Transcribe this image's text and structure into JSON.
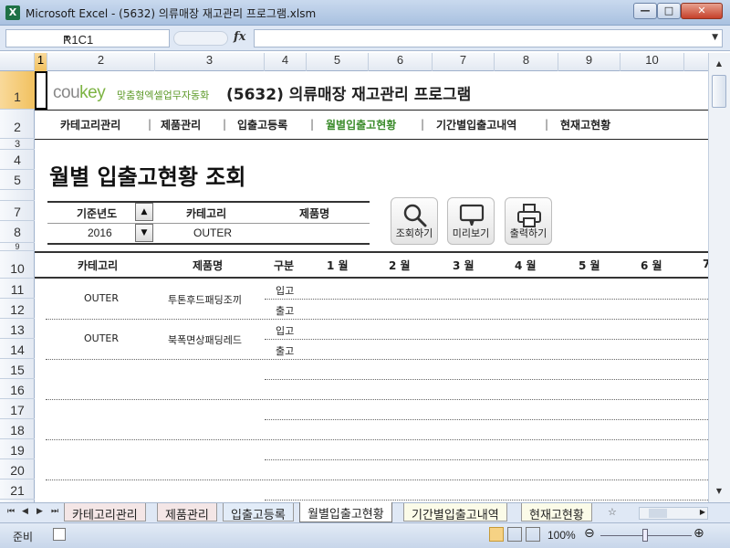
{
  "window": {
    "title": "Microsoft Excel - (5632) 의류매장 재고관리 프로그램.xlsm",
    "app_icon": "excel-icon",
    "buttons": {
      "minimize": "—",
      "maximize": "□",
      "close": "✕"
    }
  },
  "formula_bar": {
    "name_box": "R1C1",
    "fx_label": "fx",
    "formula_value": ""
  },
  "grid": {
    "column_headers": [
      "1",
      "2",
      "3",
      "4",
      "5",
      "6",
      "7",
      "8",
      "9",
      "10"
    ],
    "row_headers": [
      "1",
      "2",
      "3",
      "4",
      "5",
      "7",
      "8",
      "9",
      "10",
      "11",
      "12",
      "13",
      "14",
      "15",
      "16",
      "17",
      "18",
      "19",
      "20",
      "21"
    ],
    "selected_cell": "R1C1"
  },
  "sheet": {
    "logo": {
      "brand_a": "cou",
      "brand_b": "key",
      "tagline": "맞춤형엑셀업무자동화"
    },
    "app_title": "(5632) 의류매장 재고관리 프로그램",
    "nav": [
      {
        "label": "카테고리관리",
        "active": false
      },
      {
        "label": "제품관리",
        "active": false
      },
      {
        "label": "입출고등록",
        "active": false
      },
      {
        "label": "월별입출고현황",
        "active": true
      },
      {
        "label": "기간별입출고내역",
        "active": false
      },
      {
        "label": "현재고현황",
        "active": false
      }
    ],
    "nav_separator": "|",
    "heading": "월별 입출고현황 조회",
    "filter": {
      "year_label": "기준년도",
      "year_value": "2016",
      "category_label": "카테고리",
      "category_value": "OUTER",
      "product_label": "제품명",
      "product_value": ""
    },
    "actions": {
      "search": "조회하기",
      "preview": "미리보기",
      "print": "출력하기"
    },
    "table": {
      "headers": [
        "카테고리",
        "제품명",
        "구분",
        "1 월",
        "2 월",
        "3 월",
        "4 월",
        "5 월",
        "6 월",
        "7"
      ],
      "rows": [
        {
          "category": "OUTER",
          "product": "투톤후드패딩조끼",
          "in": "입고",
          "out": "출고"
        },
        {
          "category": "OUTER",
          "product": "북폭면상패딩레드",
          "in": "입고",
          "out": "출고"
        }
      ]
    }
  },
  "tabs": {
    "items": [
      "카테고리관리",
      "제품관리",
      "입출고등록",
      "월별입출고현황",
      "기간별입출고내역",
      "현재고현황"
    ],
    "active_index": 3
  },
  "status_bar": {
    "mode": "준비",
    "zoom": "100%",
    "zoom_level_percent": 100
  }
}
